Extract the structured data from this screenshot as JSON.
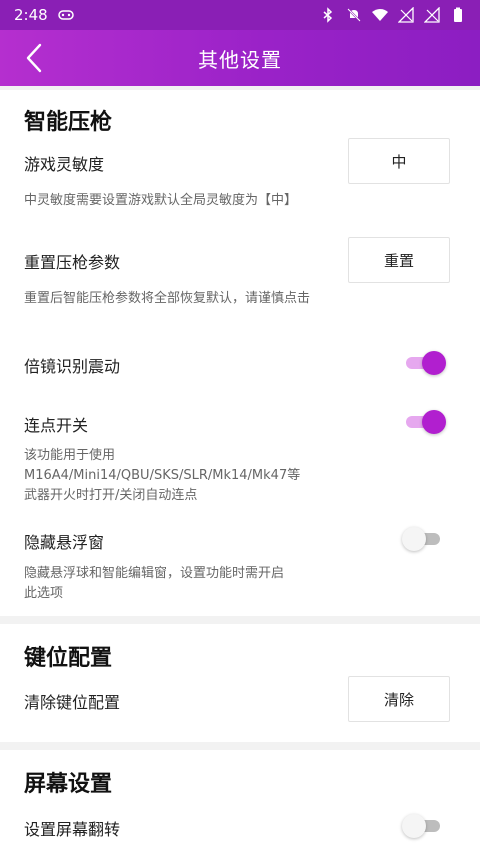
{
  "status_bar": {
    "time": "2:48"
  },
  "header": {
    "title": "其他设置"
  },
  "colors": {
    "header_start": "#b52fcf",
    "header_end": "#8c1ec2",
    "accent": "#b11fcf"
  },
  "sections": {
    "smart_recoil": {
      "title": "智能压枪",
      "sensitivity": {
        "label": "游戏灵敏度",
        "value": "中",
        "description": "中灵敏度需要设置游戏默认全局灵敏度为【中】"
      },
      "reset_params": {
        "label": "重置压枪参数",
        "button": "重置",
        "description": "重置后智能压枪参数将全部恢复默认，请谨慎点击"
      },
      "scope_vibration": {
        "label": "倍镜识别震动",
        "enabled": true
      },
      "rapid_fire": {
        "label": "连点开关",
        "enabled": true,
        "description": "该功能用于使用M16A4/Mini14/QBU/SKS/SLR/Mk14/Mk47等武器开火时打开/关闭自动连点"
      },
      "hide_float": {
        "label": "隐藏悬浮窗",
        "enabled": false,
        "description": "隐藏悬浮球和智能编辑窗，设置功能时需开启此选项"
      }
    },
    "key_config": {
      "title": "键位配置",
      "clear": {
        "label": "清除键位配置",
        "button": "清除"
      }
    },
    "screen_settings": {
      "title": "屏幕设置",
      "flip": {
        "label": "设置屏幕翻转",
        "enabled": false
      }
    }
  }
}
